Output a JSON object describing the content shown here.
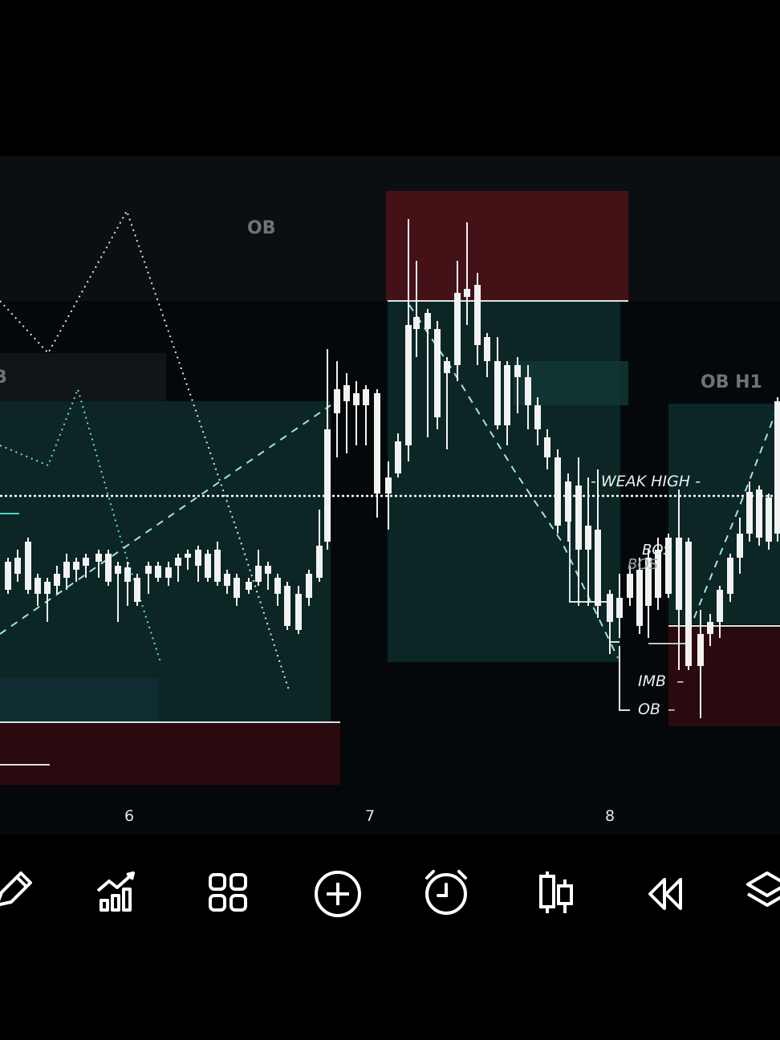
{
  "zones": {
    "ob_top": "OB",
    "ob_left_partial": "B",
    "ob_h1": "OB H1"
  },
  "annotations": {
    "weak_high": "- WEAK HIGH -",
    "bos_1": "BOS",
    "bos_2": "BOS",
    "imb": "IMB",
    "ob": "OB"
  },
  "time_axis": {
    "day_6": "6",
    "day_7": "7",
    "day_8": "8"
  },
  "toolbar": {
    "items": [
      "pencil-icon",
      "indicators-icon",
      "grid-icon",
      "add-circle-icon",
      "alarm-clock-icon",
      "candles-icon",
      "rewind-icon",
      "layers-icon"
    ]
  },
  "colors": {
    "bull_candle": "#3b6fe0",
    "bear_candle": "#f2f2f2",
    "supply_zone": "#4a1218",
    "demand_zone": "#0d2b2a",
    "weak_high_line": "#ffffff"
  }
}
